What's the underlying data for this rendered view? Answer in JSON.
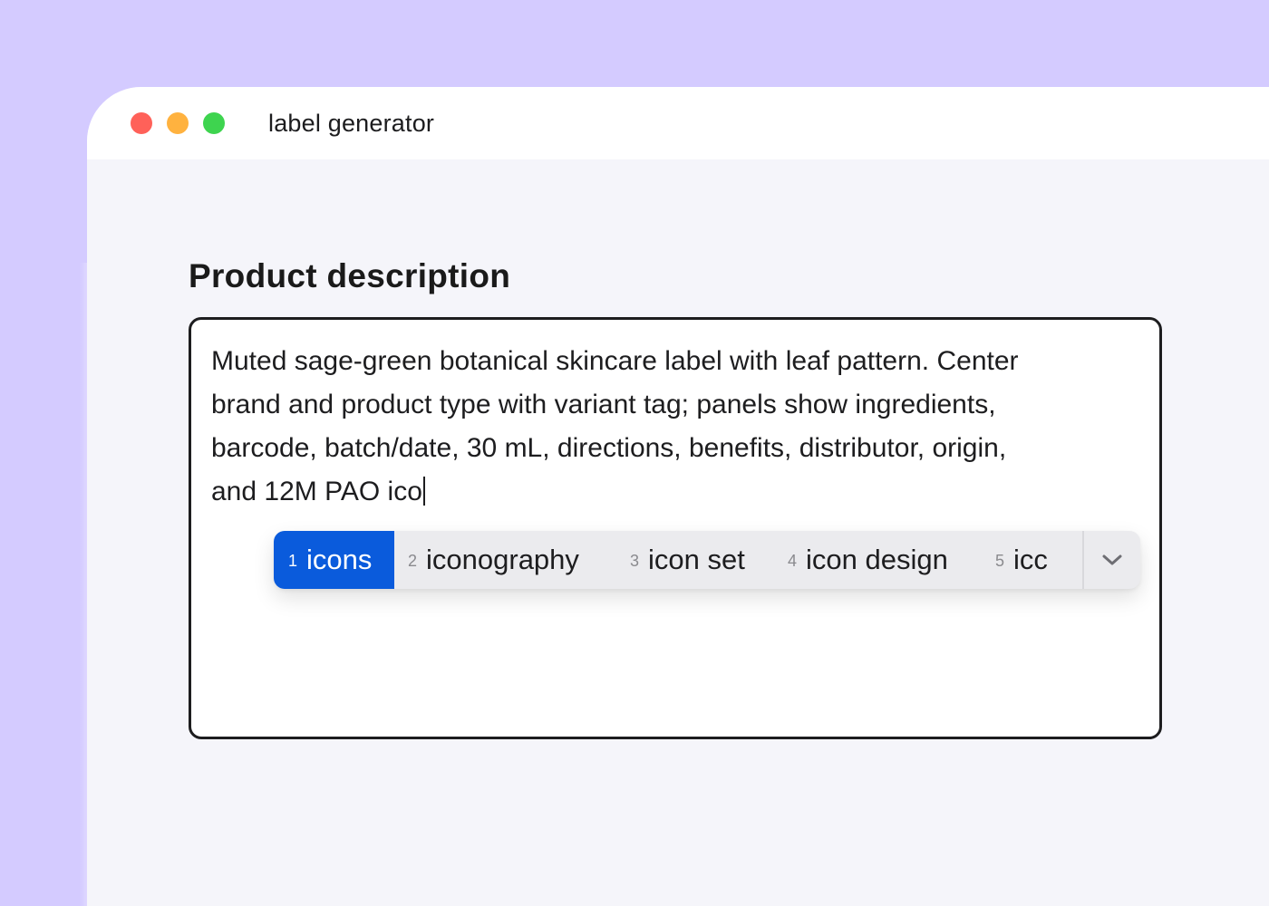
{
  "window": {
    "title": "label generator"
  },
  "form": {
    "section_title": "Product description",
    "description_value": "Muted sage-green botanical skincare label with leaf pattern. Center\nbrand and product type with variant tag; panels show ingredients,\nbarcode, batch/date, 30 mL, directions, benefits, distributor, origin,\nand 12M PAO ico"
  },
  "suggestions": {
    "items": [
      {
        "num": "1",
        "label": "icons",
        "selected": true
      },
      {
        "num": "2",
        "label": "iconography",
        "selected": false
      },
      {
        "num": "3",
        "label": "icon set",
        "selected": false
      },
      {
        "num": "4",
        "label": "icon design",
        "selected": false
      },
      {
        "num": "5",
        "label": "icc",
        "selected": false
      }
    ],
    "expand_icon": "chevron-down-icon"
  },
  "colors": {
    "background": "#d4cbff",
    "accent": "#0a5bdc",
    "traffic_red": "#ff6159",
    "traffic_yellow": "#ffb23f",
    "traffic_green": "#3ed44f"
  }
}
